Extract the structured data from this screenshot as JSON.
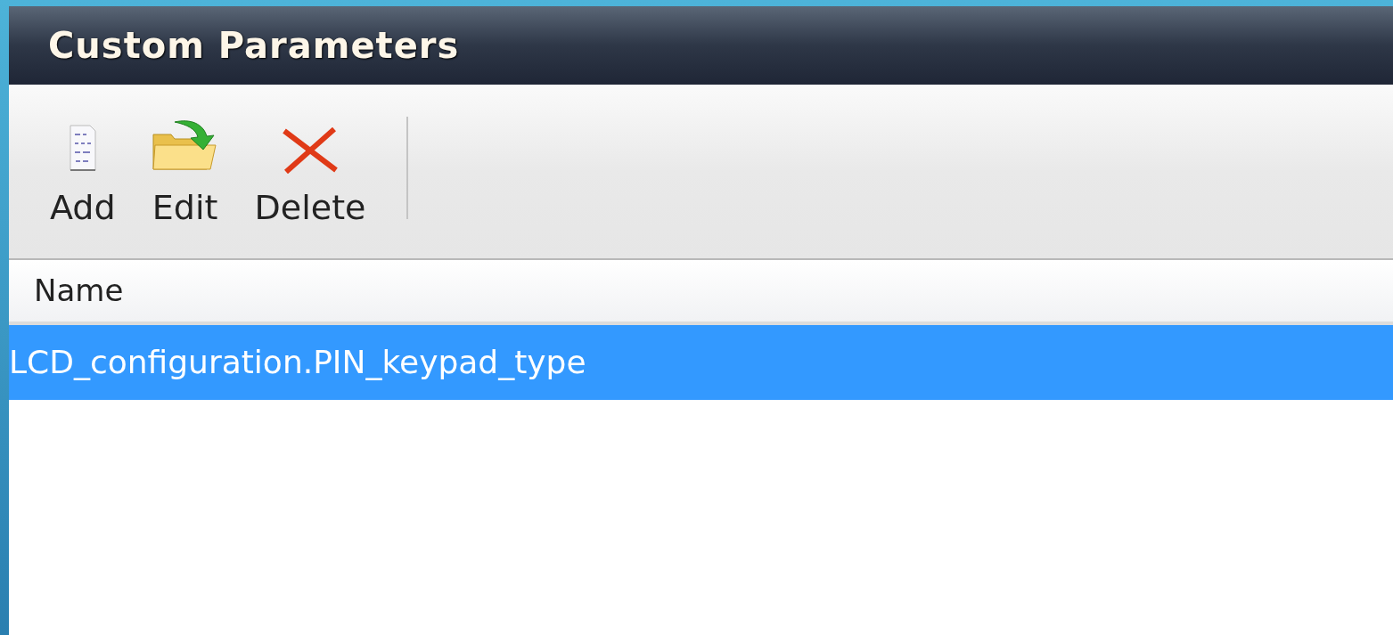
{
  "window": {
    "title": "Custom Parameters"
  },
  "toolbar": [
    {
      "kind": "add",
      "label": "Add"
    },
    {
      "kind": "edit",
      "label": "Edit"
    },
    {
      "kind": "delete",
      "label": "Delete"
    }
  ],
  "table": {
    "columns": [
      "Name"
    ],
    "rows": [
      {
        "name": "LCD_configuration.PIN_keypad_type",
        "selected": true
      }
    ]
  }
}
